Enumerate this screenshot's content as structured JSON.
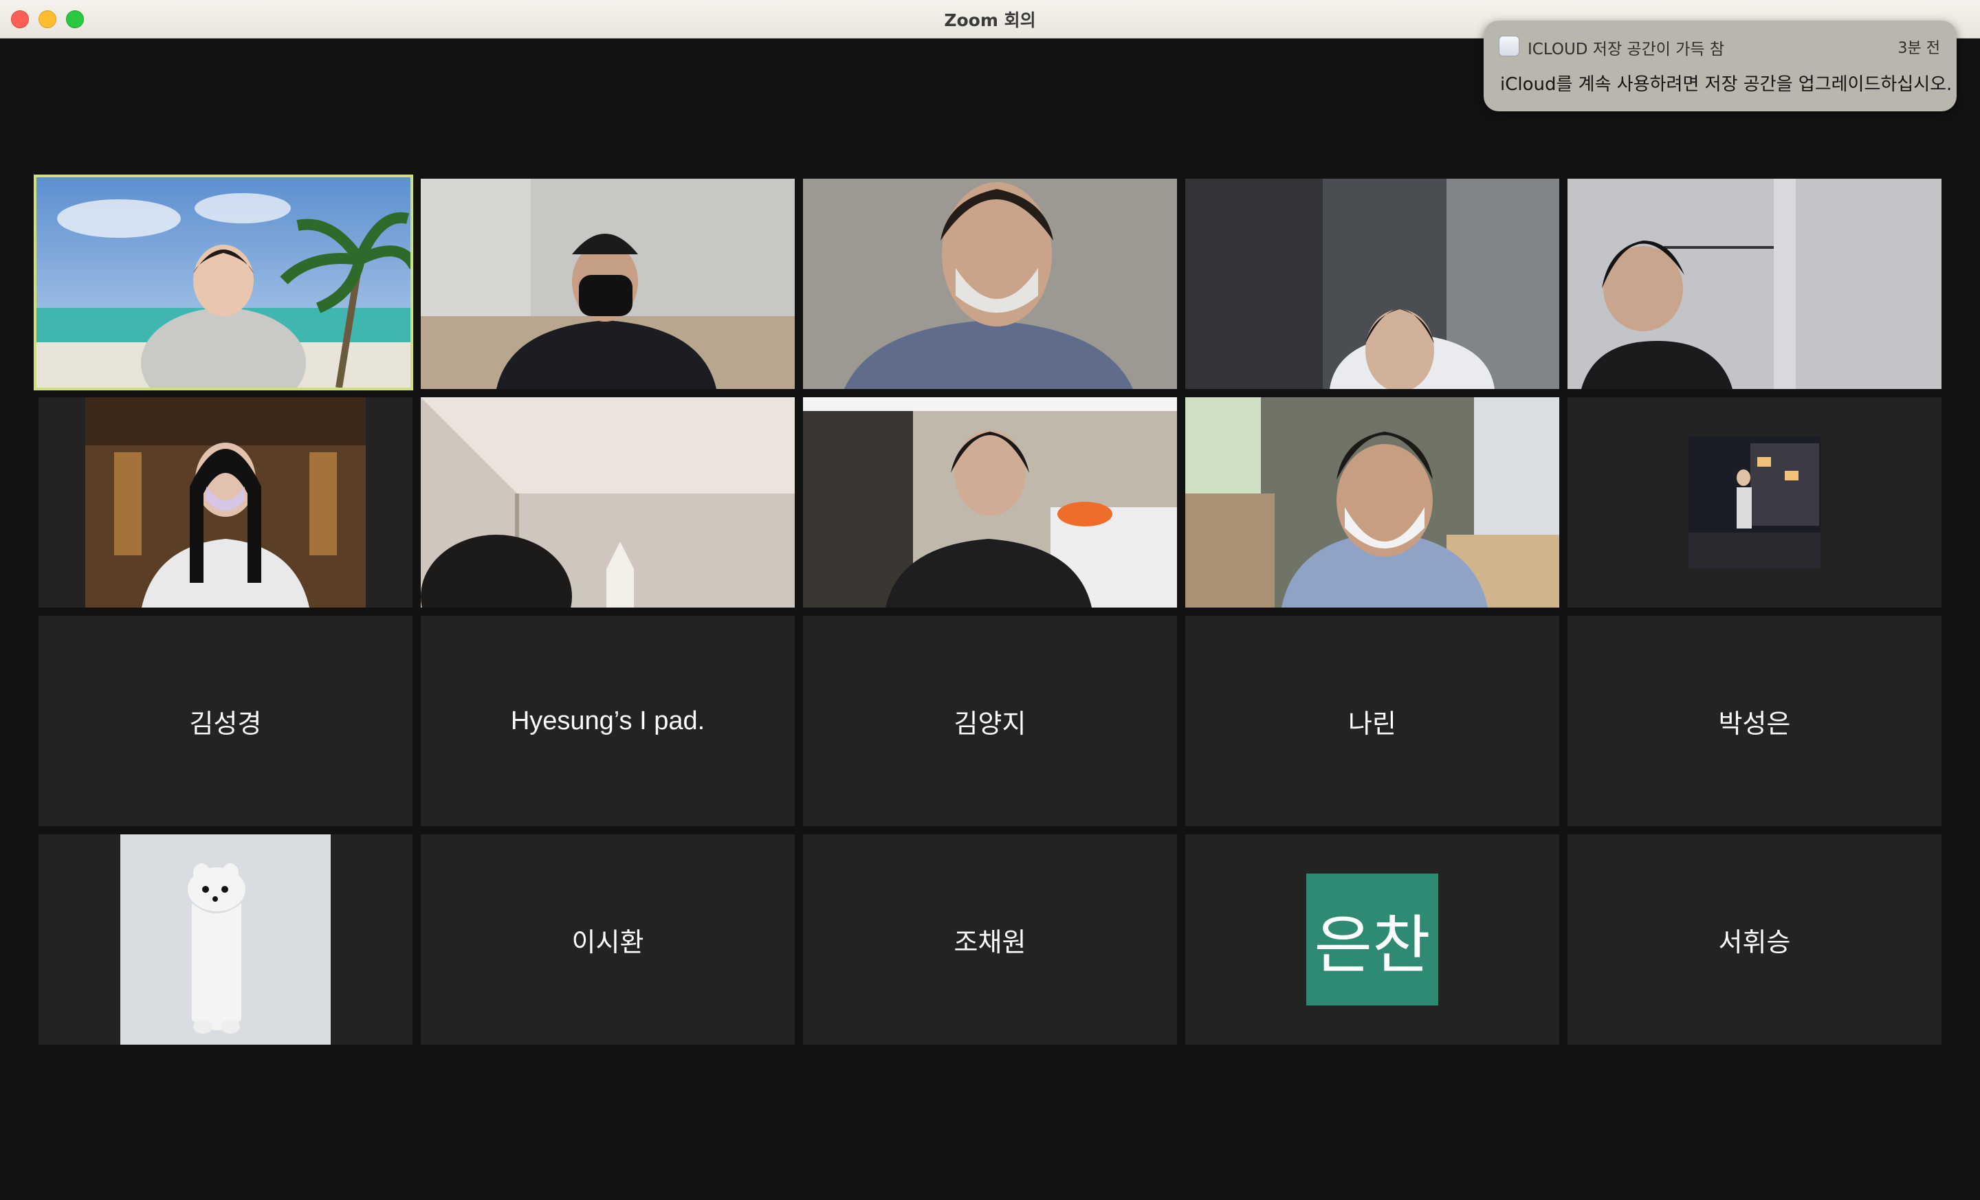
{
  "window": {
    "title": "Zoom 회의"
  },
  "notification": {
    "app": "ICLOUD 저장 공간이 가득 참",
    "time": "3분 전",
    "body": "iCloud를 계속 사용하려면 저장 공간을 업그레이드하십시오."
  },
  "participants": [
    {
      "kind": "video",
      "scene": "beach",
      "active_speaker": true
    },
    {
      "kind": "video",
      "scene": "room-man-cap"
    },
    {
      "kind": "video",
      "scene": "room-mask"
    },
    {
      "kind": "video",
      "scene": "blurred-glasses"
    },
    {
      "kind": "video",
      "scene": "room-hangers"
    },
    {
      "kind": "video",
      "scene": "library"
    },
    {
      "kind": "video",
      "scene": "ceiling"
    },
    {
      "kind": "video",
      "scene": "bedroom"
    },
    {
      "kind": "video",
      "scene": "office-headset"
    },
    {
      "kind": "profile-photo",
      "scene": "night-street"
    },
    {
      "kind": "name",
      "name": "김성경"
    },
    {
      "kind": "name",
      "name": "Hyesung’s I pad."
    },
    {
      "kind": "name",
      "name": "김양지"
    },
    {
      "kind": "name",
      "name": "나린"
    },
    {
      "kind": "name",
      "name": "박성은"
    },
    {
      "kind": "profile-photo",
      "scene": "white-weasel"
    },
    {
      "kind": "name",
      "name": "이시환"
    },
    {
      "kind": "name",
      "name": "조채원"
    },
    {
      "kind": "avatar",
      "initials": "은찬",
      "color": "#2f8a74"
    },
    {
      "kind": "name",
      "name": "서휘승"
    }
  ],
  "colors": {
    "speaker_border": "#cfe07a",
    "tile_bg": "#232323",
    "stage_bg": "#121212"
  }
}
